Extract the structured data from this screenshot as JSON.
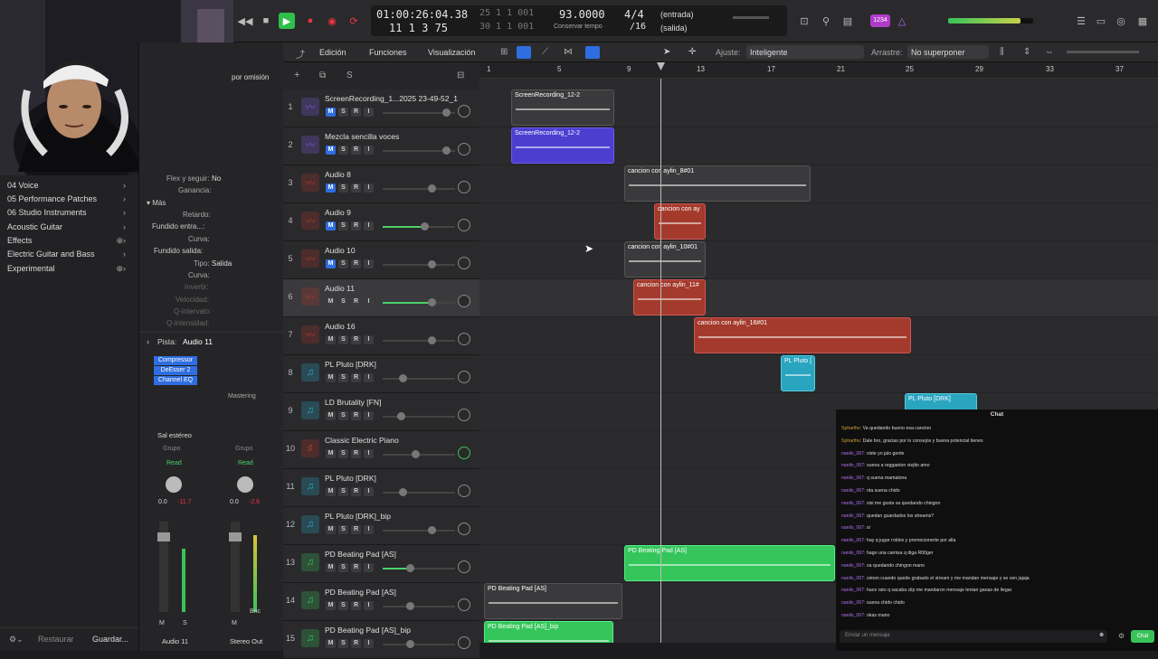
{
  "transport": {
    "position": "01:00:26:04.38",
    "bars": "11  1  3  75",
    "bars_small": "25  1  1  001",
    "bars_small2": "30  1  1  001",
    "tempo": "93.0000",
    "tempo_label": "Conservar tempo",
    "signature": "4/4",
    "division": "/16",
    "in_label": "(entrada)",
    "out_label": "(salida)",
    "badge": "1234"
  },
  "library": {
    "items": [
      {
        "label": "04 Voice"
      },
      {
        "label": "05 Performance Patches"
      },
      {
        "label": "06 Studio Instruments"
      },
      {
        "label": "Acoustic Guitar"
      },
      {
        "label": "Effects"
      },
      {
        "label": "Electric Guitar and Bass"
      },
      {
        "label": "Experimental"
      }
    ],
    "restore_label": "Restaurar",
    "save_label": "Guardar..."
  },
  "inspector": {
    "header_label": "por omisión",
    "flex_label": "Flex y seguir:",
    "flex_value": "No",
    "gain_label": "Ganancia:",
    "more_label": "Más",
    "delay_label": "Retardo:",
    "fadein_label": "Fundido entra...:",
    "curve_label": "Curva:",
    "fadeout_label": "Fundido salida:",
    "curve2_label": "Curva:",
    "type_label": "Tipo:",
    "type_value": "Salida",
    "curve3_label": "Curva:",
    "invert_label": "Invertir:",
    "velocity_label": "Velocidad:",
    "qrange_label": "Q-intervalo:",
    "qstrength_label": "Q-intensidad:",
    "track_label": "Pista:",
    "track_value": "Audio 11",
    "plugins": [
      "Compressor",
      "DeEsser 2",
      "Channel EQ"
    ],
    "mastering": "Mastering",
    "stereo_out": "Sal estéreo",
    "group1": "Grupo",
    "group2": "Grupo",
    "read1": "Read",
    "read2": "Read",
    "val1": "0.0",
    "val1b": "-11.7",
    "val2": "0.0",
    "val2b": "-2.6",
    "strip1_name": "Audio 11",
    "strip2_name": "Stereo Out",
    "bnc": "Bnc",
    "m1": "M",
    "s1": "S",
    "m2": "M"
  },
  "toolbar": {
    "edit": "Edición",
    "functions": "Funciones",
    "view": "Visualización",
    "snap_label": "Ajuste:",
    "snap_value": "Inteligente",
    "drag_label": "Arrastre:",
    "drag_value": "No superponer"
  },
  "ruler": {
    "marks": [
      "1",
      "5",
      "9",
      "13",
      "17",
      "21",
      "25",
      "29",
      "33",
      "37"
    ]
  },
  "tracks": [
    {
      "num": "1",
      "name": "ScreenRecording_1...2025 23-49-52_1",
      "icon": "waveform-icon",
      "color": "#7b5fe0",
      "mute": true,
      "vol": 0.88
    },
    {
      "num": "2",
      "name": "Mezcla sencilla voces",
      "icon": "waveform-icon",
      "color": "#7b5fe0",
      "mute": true,
      "vol": 0.88
    },
    {
      "num": "3",
      "name": "Audio 8",
      "icon": "waveform-icon",
      "color": "#b23a2e",
      "mute": true,
      "vol": 0.68
    },
    {
      "num": "4",
      "name": "Audio 9",
      "icon": "waveform-icon",
      "color": "#b23a2e",
      "mute": true,
      "vol": 0.58
    },
    {
      "num": "5",
      "name": "Audio 10",
      "icon": "waveform-icon",
      "color": "#b23a2e",
      "mute": true,
      "vol": 0.68
    },
    {
      "num": "6",
      "name": "Audio 11",
      "icon": "waveform-icon",
      "color": "#b23a2e",
      "mute": false,
      "vol": 0.68
    },
    {
      "num": "7",
      "name": "Audio 16",
      "icon": "waveform-icon",
      "color": "#b23a2e",
      "mute": false,
      "vol": 0.68
    },
    {
      "num": "8",
      "name": "PL Pluto [DRK]",
      "icon": "note-icon",
      "color": "#2ea8c9",
      "mute": false,
      "vol": 0.28
    },
    {
      "num": "9",
      "name": "LD Brutality [FN]",
      "icon": "note-icon",
      "color": "#2ea8c9",
      "mute": false,
      "vol": 0.25
    },
    {
      "num": "10",
      "name": "Classic Electric Piano",
      "icon": "piano-icon",
      "color": "#b23a2e",
      "mute": false,
      "vol": 0.45
    },
    {
      "num": "11",
      "name": "PL Pluto [DRK]",
      "icon": "note-icon",
      "color": "#2ea8c9",
      "mute": false,
      "vol": 0.28
    },
    {
      "num": "12",
      "name": "PL Pluto [DRK]_bip",
      "icon": "note-icon",
      "color": "#2ea8c9",
      "mute": false,
      "vol": 0.68
    },
    {
      "num": "13",
      "name": "PD Beating Pad [AS]",
      "icon": "note-icon",
      "color": "#3ac25a",
      "mute": false,
      "vol": 0.38
    },
    {
      "num": "14",
      "name": "PD Beating Pad [AS]",
      "icon": "note-icon",
      "color": "#3ac25a",
      "mute": false,
      "vol": 0.38
    },
    {
      "num": "15",
      "name": "PD Beating Pad [AS]_bip",
      "icon": "note-icon",
      "color": "#3ac25a",
      "mute": false,
      "vol": 0.38
    }
  ],
  "regions": [
    {
      "label": "ScreenRecording_12-2",
      "color": "#3a3a3c",
      "border": "#555"
    },
    {
      "label": "ScreenRecording_12-2",
      "color": "#4c3fd0",
      "border": "#6a5af0"
    },
    {
      "label": "cancion con aylin_8#01",
      "color": "#3a3a3c",
      "border": "#555"
    },
    {
      "label": "cancion con ay",
      "color": "#a43a2c",
      "border": "#c55"
    },
    {
      "label": "cancion con aylin_10#01",
      "color": "#3a3a3c",
      "border": "#555"
    },
    {
      "label": "cancion con aylin_11#",
      "color": "#a43a2c",
      "border": "#c55"
    },
    {
      "label": "cancion con aylin_16#01",
      "color": "#a43a2c",
      "border": "#c55"
    },
    {
      "label": "PL Pluto [",
      "color": "#2aa5c0",
      "border": "#5cd"
    },
    {
      "label": "PL Pluto [DRK]",
      "color": "#2aa5c0",
      "border": "#5cd"
    },
    {
      "label": "PD Beating Pad [AS]",
      "color": "#34c65a",
      "border": "#5e8"
    },
    {
      "label": "PD Beating Pad [AS]",
      "color": "#3a3a3c",
      "border": "#555"
    },
    {
      "label": "PD Beating Pad [AS]_bip",
      "color": "#34c65a",
      "border": "#5e8"
    }
  ],
  "chat": {
    "title": "Chat",
    "placeholder": "Enviar un mensaje",
    "send_label": "Chat",
    "messages": [
      {
        "user": "Spharths:",
        "text": "Va quedando bueno esa cancion",
        "style": "user2"
      },
      {
        "user": "Spharths:",
        "text": "Dale bro, gracias por lo consejos y buena potencial tienes",
        "style": "user2"
      },
      {
        "user": "nanilx_007:",
        "text": "viste yo jalo gente",
        "style": "user"
      },
      {
        "user": "nanilx_007:",
        "text": "suena a reggaeton viejito amo",
        "style": "user"
      },
      {
        "user": "nanilx_007:",
        "text": "q suena mamalona",
        "style": "user"
      },
      {
        "user": "nanilx_007:",
        "text": "nta suena chido",
        "style": "user"
      },
      {
        "user": "nanilx_007:",
        "text": "sisi me gusta va quedando chingon",
        "style": "user"
      },
      {
        "user": "nanilx_007:",
        "text": "quedan guardados los streams?",
        "style": "user"
      },
      {
        "user": "nanilx_007:",
        "text": "si",
        "style": "user"
      },
      {
        "user": "nanilx_007:",
        "text": "hay q jugar roblox y promocionerte por alla",
        "style": "user"
      },
      {
        "user": "nanilx_007:",
        "text": "hago una camisa q diga R00ger",
        "style": "user"
      },
      {
        "user": "nanilx_007:",
        "text": "va quedando chingon mano",
        "style": "user"
      },
      {
        "user": "nanilx_007:",
        "text": "simon cuando quede grabado el stream y me mandan mensaje y se ven jajaja",
        "style": "user"
      },
      {
        "user": "nanilx_007:",
        "text": "hace rato q sacaba clip me mandaron mensaje tenian ganas de llegar",
        "style": "user"
      },
      {
        "user": "nanilx_007:",
        "text": "suena chido chido",
        "style": "user"
      },
      {
        "user": "nanilx_007:",
        "text": "okas mano",
        "style": "user"
      }
    ]
  }
}
